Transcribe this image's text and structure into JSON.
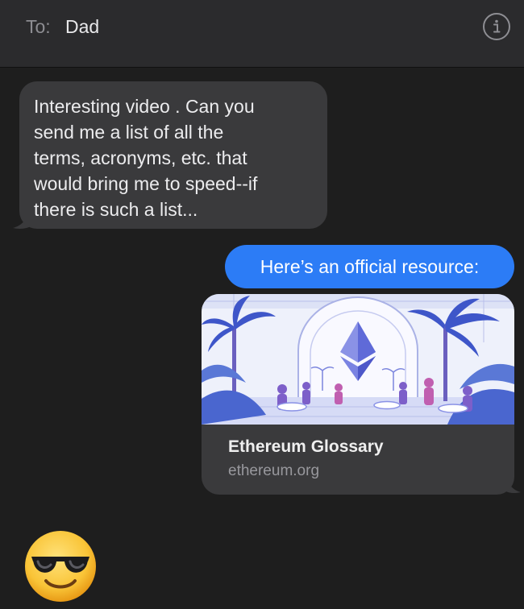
{
  "header": {
    "to_label": "To:",
    "recipient": "Dad",
    "info_icon": "info-circle-icon"
  },
  "messages": {
    "received_text": "Interesting video . Can you\nsend me a list of all the\nterms, acronyms, etc. that\nwould bring me to speed--if\nthere is such a list...",
    "sent_text": "Here’s an official resource:",
    "link_preview": {
      "title": "Ethereum Glossary",
      "domain": "ethereum.org",
      "image_icon": "ethereum-diamond-icon"
    },
    "emoji": "smiling-face-with-sunglasses-icon"
  },
  "colors": {
    "background": "#1e1e1e",
    "header": "#2b2b2d",
    "received_bubble": "#3a3a3c",
    "sent_bubble": "#2c7cf6",
    "muted_text": "#8d8d92"
  }
}
